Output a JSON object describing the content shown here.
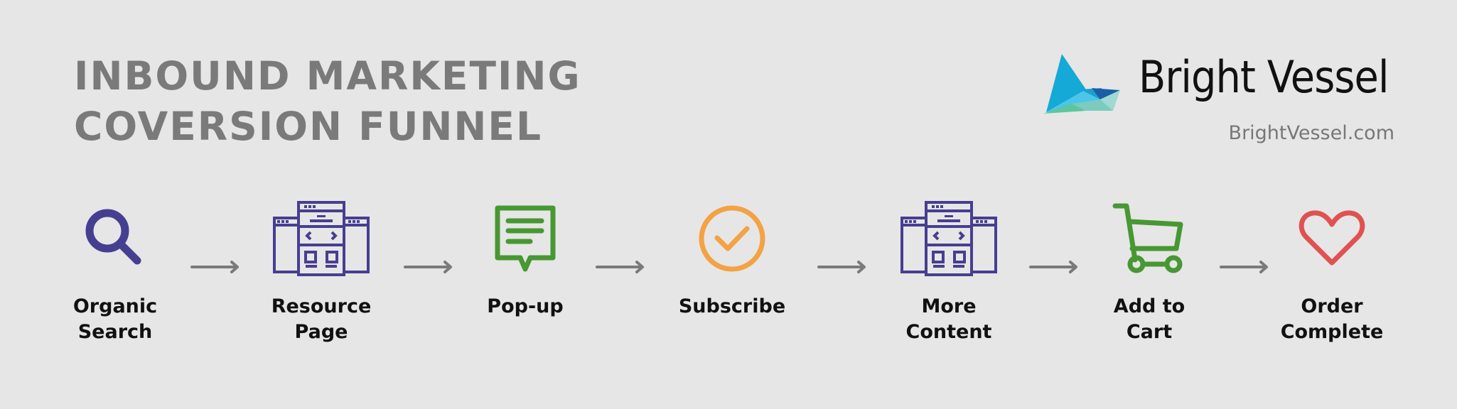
{
  "title": {
    "line1": "INBOUND MARKETING",
    "line2": "COVERSION FUNNEL"
  },
  "brand": {
    "name": "Bright Vessel",
    "url": "BrightVessel.com",
    "logo_icon": "paper-boat-icon"
  },
  "colors": {
    "background": "#e6e6e6",
    "title": "#7a7a7a",
    "purple": "#463f91",
    "green": "#479833",
    "orange": "#f3a244",
    "red": "#e05252",
    "arrow": "#7a7a7a"
  },
  "steps": [
    {
      "icon": "magnifier-icon",
      "label_line1": "Organic",
      "label_line2": "Search"
    },
    {
      "icon": "web-page-layout-icon",
      "label_line1": "Resource",
      "label_line2": "Page"
    },
    {
      "icon": "speech-bubble-icon",
      "label_line1": "Pop-up",
      "label_line2": ""
    },
    {
      "icon": "check-circle-icon",
      "label_line1": "Subscribe",
      "label_line2": ""
    },
    {
      "icon": "web-page-layout-icon",
      "label_line1": "More",
      "label_line2": "Content"
    },
    {
      "icon": "shopping-cart-icon",
      "label_line1": "Add to",
      "label_line2": "Cart"
    },
    {
      "icon": "heart-icon",
      "label_line1": "Order",
      "label_line2": "Complete"
    }
  ],
  "arrow_icon": "right-arrow-icon"
}
